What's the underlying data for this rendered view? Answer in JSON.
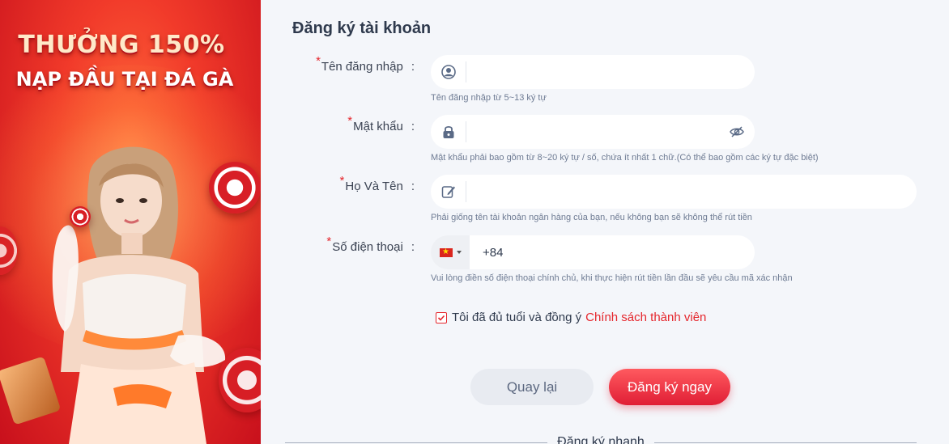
{
  "banner": {
    "headline_line1": "THƯỞNG 150%",
    "headline_line2": "NẠP ĐẦU TẠI ĐÁ GÀ"
  },
  "form": {
    "title": "Đăng ký tài khoản",
    "required_mark": "*",
    "colon": ":",
    "username": {
      "label": "Tên đăng nhập",
      "value": "",
      "hint": "Tên đăng nhập từ 5~13 ký tự",
      "icon": "user-icon"
    },
    "password": {
      "label": "Mật khẩu",
      "value": "",
      "hint": "Mật khẩu phải bao gồm từ 8~20 ký tự / số, chứa ít nhất 1 chữ.(Có thể bao gồm các ký tự đặc biệt)",
      "icon": "lock-icon",
      "toggle_icon": "eye-off-icon"
    },
    "fullname": {
      "label": "Họ Và Tên",
      "value": "",
      "hint": "Phải giống tên tài khoản ngân hàng của bạn, nếu không bạn sẽ không thể rút tiền",
      "icon": "edit-icon"
    },
    "phone": {
      "label": "Số điện thoại",
      "country": "vietnam-flag-icon",
      "prefix": "+84",
      "value": "",
      "hint": "Vui lòng điền số điện thoại chính chủ, khi thực hiện rút tiền lần đầu sẽ yêu cầu mã xác nhận"
    },
    "agreement": {
      "checked": true,
      "text": "Tôi đã đủ tuổi và đồng ý",
      "link": "Chính sách thành viên"
    },
    "back_button": "Quay lại",
    "submit_button": "Đăng ký ngay",
    "quick_register": "Đăng ký nhanh"
  },
  "colors": {
    "accent": "#e5262c",
    "background": "#f4f6fa",
    "hint": "#6e7b93"
  }
}
